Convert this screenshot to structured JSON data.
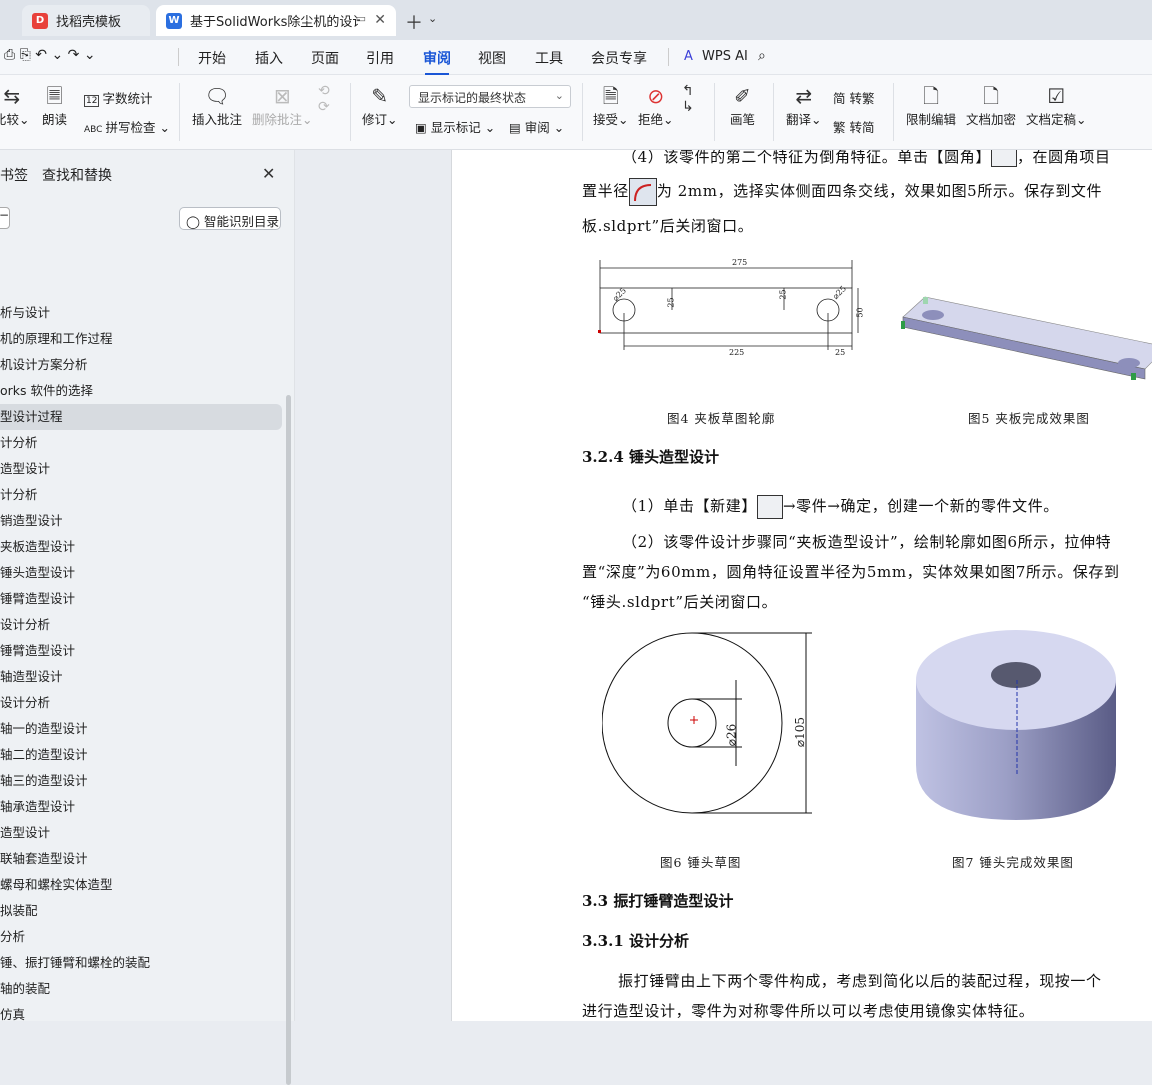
{
  "tabs": {
    "tab2_label": "找稻壳模板",
    "tab3_label": "基于SolidWorks除尘机的设计",
    "tab3_icon": "W"
  },
  "menu": [
    "开始",
    "插入",
    "页面",
    "引用",
    "审阅",
    "视图",
    "工具",
    "会员专享",
    "WPS AI"
  ],
  "ribbon": {
    "compare": "比较",
    "read_aloud": "朗读",
    "word_count": "字数统计",
    "spell_check": "拼写检查",
    "insert_comment": "插入批注",
    "delete_comment": "删除批注",
    "track": "修订",
    "markup_select": "显示标记的最终状态",
    "show_markup": "显示标记",
    "review": "审阅",
    "accept": "接受",
    "reject": "拒绝",
    "pen": "画笔",
    "trad": "简 转繁",
    "translate": "翻译",
    "simp": "繁 转简",
    "restrict": "限制编辑",
    "encrypt": "文档加密",
    "finalize": "文档定稿"
  },
  "sidebar": {
    "tab_bookmark": "书签",
    "tab_find": "查找和替换",
    "smart_toc": "智能识别目录",
    "toc": [
      "析与设计",
      "机的原理和工作过程",
      "机设计方案分析",
      "orks 软件的选择",
      "型设计过程",
      "计分析",
      "造型设计",
      "计分析",
      "销造型设计",
      "夹板造型设计",
      "锤头造型设计",
      "锤臂造型设计",
      "设计分析",
      "锤臂造型设计",
      "轴造型设计",
      "设计分析",
      "轴一的造型设计",
      "轴二的造型设计",
      "轴三的造型设计",
      "轴承造型设计",
      "造型设计",
      "联轴套造型设计",
      "螺母和螺栓实体造型",
      "拟装配",
      "分析",
      "锤、振打锤臂和螺栓的装配",
      "轴的装配",
      "仿真"
    ],
    "selected_index": 4
  },
  "doc": {
    "line1": "（4）该零件的第二个特征为倒角特征。单击【圆角】",
    "line1b": "，在圆角项目",
    "line2a": "置半径",
    "line2b": "为 2mm，选择实体侧面四条交线，效果如图5所示。保存到文件",
    "line3": "板.sldprt”后关闭窗口。",
    "fig4_caption": "图4  夹板草图轮廓",
    "fig5_caption": "图5  夹板完成效果图",
    "h_324": "3.2.4  锤头造型设计",
    "p_new_a": "（1）单击【新建】",
    "p_new_b": "→零件→确定，创建一个新的零件文件。",
    "p2_l1": "（2）该零件设计步骤同“夹板造型设计”，绘制轮廓如图6所示，拉伸特",
    "p2_l2": "置“深度”为60mm，圆角特征设置半径为5mm，实体效果如图7所示。保存到",
    "p2_l3": "“锤头.sldprt”后关闭窗口。",
    "fig6_caption": "图6  锤头草图",
    "fig7_caption": "图7  锤头完成效果图",
    "h_33": "3.3  振打锤臂造型设计",
    "h_331": "3.3.1  设计分析",
    "p3_l1": "振打锤臂由上下两个零件构成，考虑到简化以后的装配过程，现按一个",
    "p3_l2": "进行造型设计，零件为对称零件所以可以考虑使用镜像实体特征。"
  },
  "dims": {
    "d275": "275",
    "d225": "225",
    "d25a": "25",
    "d25b": "25",
    "d25c": "25",
    "d25d": "25",
    "d50": "50",
    "phi25a": "⌀25",
    "phi25b": "⌀25",
    "phi26": "⌀26",
    "phi105": "⌀105"
  },
  "colors": {
    "accent": "#1a56d6",
    "sidebar_bg": "#eef1f4",
    "page_bg": "#ffffff"
  }
}
